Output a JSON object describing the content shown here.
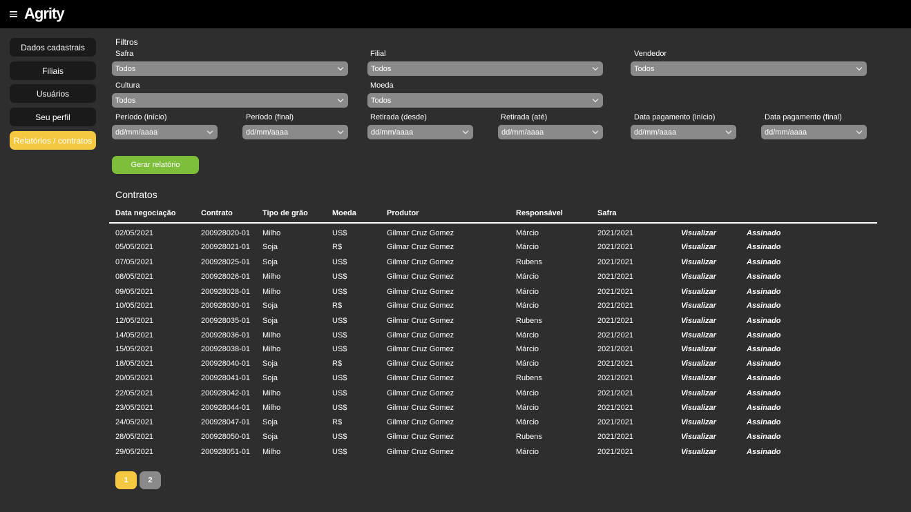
{
  "header": {
    "logo": "Agrity",
    "menu_icon": "hamburger-menu-icon"
  },
  "sidebar": {
    "items": [
      {
        "label": "Dados cadastrais",
        "active": false
      },
      {
        "label": "Filiais",
        "active": false
      },
      {
        "label": "Usuários",
        "active": false
      },
      {
        "label": "Seu perfil",
        "active": false
      },
      {
        "label": "Relatórios / contratos",
        "active": true
      }
    ]
  },
  "filters": {
    "title": "Filtros",
    "safra": {
      "label": "Safra",
      "value": "Todos"
    },
    "filial": {
      "label": "Filial",
      "value": "Todos"
    },
    "vendedor": {
      "label": "Vendedor",
      "value": "Todos"
    },
    "cultura": {
      "label": "Cultura",
      "value": "Todos"
    },
    "moeda": {
      "label": "Moeda",
      "value": "Todos"
    },
    "periodo_inicio": {
      "label": "Período (início)",
      "value": "dd/mm/aaaa"
    },
    "periodo_final": {
      "label": "Período (final)",
      "value": "dd/mm/aaaa"
    },
    "retirada_desde": {
      "label": "Retirada (desde)",
      "value": "dd/mm/aaaa"
    },
    "retirada_ate": {
      "label": "Retirada (até)",
      "value": "dd/mm/aaaa"
    },
    "pagamento_inicio": {
      "label": "Data pagamento (início)",
      "value": "dd/mm/aaaa"
    },
    "pagamento_final": {
      "label": "Data pagamento (final)",
      "value": "dd/mm/aaaa"
    },
    "generate_button": "Gerar relatório"
  },
  "contracts": {
    "title": "Contratos",
    "columns": [
      "Data negociação",
      "Contrato",
      "Tipo de grão",
      "Moeda",
      "Produtor",
      "Responsável",
      "Safra"
    ],
    "action_view": "Visualizar",
    "rows": [
      [
        "02/05/2021",
        "200928020-01",
        "Milho",
        "US$",
        "Gilmar Cruz Gomez",
        "Márcio",
        "2021/2021",
        "Assinado"
      ],
      [
        "05/05/2021",
        "200928021-01",
        "Soja",
        "R$",
        "Gilmar Cruz Gomez",
        "Márcio",
        "2021/2021",
        "Assinado"
      ],
      [
        "07/05/2021",
        "200928025-01",
        "Soja",
        "US$",
        "Gilmar Cruz Gomez",
        "Rubens",
        "2021/2021",
        "Assinado"
      ],
      [
        "08/05/2021",
        "200928026-01",
        "Milho",
        "US$",
        "Gilmar Cruz Gomez",
        "Márcio",
        "2021/2021",
        "Assinado"
      ],
      [
        "09/05/2021",
        "200928028-01",
        "Milho",
        "US$",
        "Gilmar Cruz Gomez",
        "Márcio",
        "2021/2021",
        "Assinado"
      ],
      [
        "10/05/2021",
        "200928030-01",
        "Soja",
        "R$",
        "Gilmar Cruz Gomez",
        "Márcio",
        "2021/2021",
        "Assinado"
      ],
      [
        "12/05/2021",
        "200928035-01",
        "Soja",
        "US$",
        "Gilmar Cruz Gomez",
        "Rubens",
        "2021/2021",
        "Assinado"
      ],
      [
        "14/05/2021",
        "200928036-01",
        "Milho",
        "US$",
        "Gilmar Cruz Gomez",
        "Márcio",
        "2021/2021",
        "Assinado"
      ],
      [
        "15/05/2021",
        "200928038-01",
        "Milho",
        "US$",
        "Gilmar Cruz Gomez",
        "Márcio",
        "2021/2021",
        "Assinado"
      ],
      [
        "18/05/2021",
        "200928040-01",
        "Soja",
        "R$",
        "Gilmar Cruz Gomez",
        "Márcio",
        "2021/2021",
        "Assinado"
      ],
      [
        "20/05/2021",
        "200928041-01",
        "Soja",
        "US$",
        "Gilmar Cruz Gomez",
        "Rubens",
        "2021/2021",
        "Assinado"
      ],
      [
        "22/05/2021",
        "200928042-01",
        "Milho",
        "US$",
        "Gilmar Cruz Gomez",
        "Márcio",
        "2021/2021",
        "Assinado"
      ],
      [
        "23/05/2021",
        "200928044-01",
        "Milho",
        "US$",
        "Gilmar Cruz Gomez",
        "Márcio",
        "2021/2021",
        "Assinado"
      ],
      [
        "24/05/2021",
        "200928047-01",
        "Soja",
        "R$",
        "Gilmar Cruz Gomez",
        "Márcio",
        "2021/2021",
        "Assinado"
      ],
      [
        "28/05/2021",
        "200928050-01",
        "Soja",
        "US$",
        "Gilmar Cruz Gomez",
        "Rubens",
        "2021/2021",
        "Assinado"
      ],
      [
        "29/05/2021",
        "200928051-01",
        "Milho",
        "US$",
        "Gilmar Cruz Gomez",
        "Márcio",
        "2021/2021",
        "Assinado"
      ]
    ]
  },
  "pagination": {
    "pages": [
      {
        "label": "1",
        "active": true
      },
      {
        "label": "2",
        "active": false
      }
    ]
  },
  "colors": {
    "accent": "#f5c842",
    "action": "#7dbf3a",
    "inactive_page": "#8a8a8a"
  }
}
